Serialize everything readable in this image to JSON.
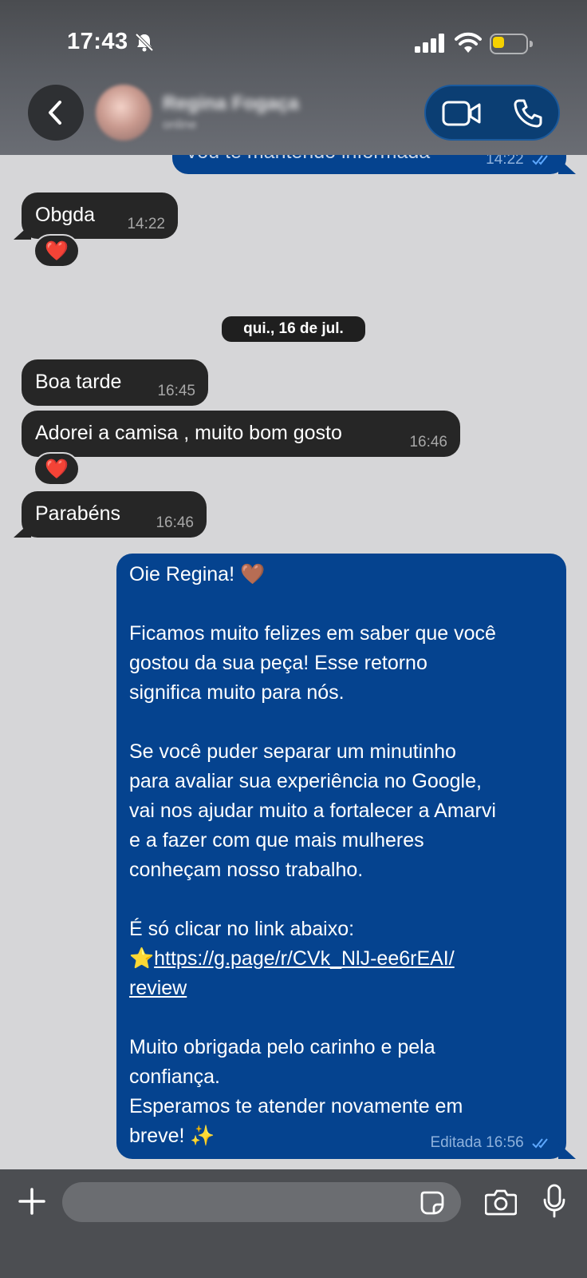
{
  "status_bar": {
    "time": "17:43",
    "battery_level": 0.35,
    "battery_color": "#f5d100",
    "icons": [
      "bell-slash-icon",
      "cellular-signal-icon",
      "wifi-icon",
      "battery-icon"
    ]
  },
  "header": {
    "contact_name": "Regina Fogaça",
    "contact_status": "online",
    "back_icon": "chevron-left-icon",
    "video_icon": "video-camera-icon",
    "call_icon": "phone-icon",
    "accent_color": "#0b3e73"
  },
  "messages": {
    "partial_top": {
      "text": "Vou te mantendo informada",
      "time": "14:22"
    },
    "m1": {
      "text": "Obgda",
      "time": "14:22",
      "reaction": "❤️"
    },
    "date_separator": "qui., 16 de jul.",
    "m2": {
      "text": "Boa tarde",
      "time": "16:45"
    },
    "m3": {
      "text": "Adorei a camisa , muito bom gosto",
      "time": "16:46",
      "reaction": "❤️"
    },
    "m4": {
      "text": "Parabéns",
      "time": "16:46"
    },
    "m5": {
      "line1": "Oie Regina! 🤎",
      "para2": [
        "Ficamos muito felizes em saber que você",
        "gostou da sua peça! Esse retorno",
        "significa muito para nós."
      ],
      "para3": [
        "Se você puder separar um minutinho",
        "para avaliar sua experiência no Google,",
        "vai nos ajudar muito a fortalecer a Amarvi",
        "e a fazer com que mais mulheres",
        "conheçam nosso trabalho."
      ],
      "link_intro": "É só clicar no link abaixo:",
      "star": "⭐",
      "link_part1": "https://g.page/r/CVk_NlJ-ee6rEAI/",
      "link_part2": "review",
      "para5": [
        "Muito obrigada pelo carinho e pela",
        "confiança.",
        "Esperamos te atender novamente em",
        "breve! ✨"
      ],
      "edited_label": "Editada",
      "time": "16:56"
    }
  },
  "colors": {
    "incoming_bubble": "#262626",
    "outgoing_bubble": "#05438f",
    "chat_background": "#d6d6d8",
    "read_ticks": "#5ea8ff"
  },
  "input_bar": {
    "placeholder": "",
    "icons": [
      "plus-icon",
      "sticker-icon",
      "camera-icon",
      "microphone-icon"
    ]
  }
}
